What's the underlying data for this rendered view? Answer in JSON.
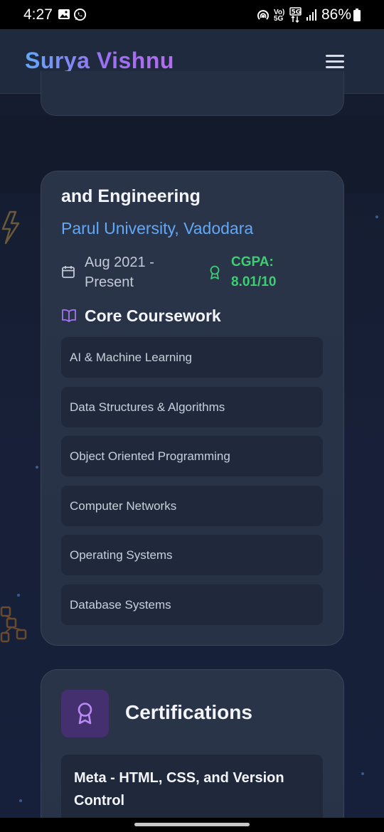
{
  "status_bar": {
    "time": "4:27",
    "battery": "86%",
    "net_top": "Vo)",
    "net_bottom": "5G"
  },
  "header": {
    "brand": "Surya Vishnu",
    "menu_icon": "hamburger-menu-icon"
  },
  "education": {
    "title_fragment": "and Engineering",
    "school": "Parul University, Vadodara",
    "date": "Aug 2021 - Present",
    "cgpa": "CGPA: 8.01/10",
    "coursework_title": "Core Coursework",
    "coursework": [
      "AI & Machine Learning",
      "Data Structures & Algorithms",
      "Object Oriented Programming",
      "Computer Networks",
      "Operating Systems",
      "Database Systems"
    ]
  },
  "certifications": {
    "title": "Certifications",
    "items": [
      "Meta - HTML, CSS, and Version Control"
    ]
  },
  "colors": {
    "accent_blue": "#62a8f6",
    "accent_purple": "#9b6ef3",
    "success_green": "#3fcd74",
    "card_bg": "#2a3448"
  }
}
